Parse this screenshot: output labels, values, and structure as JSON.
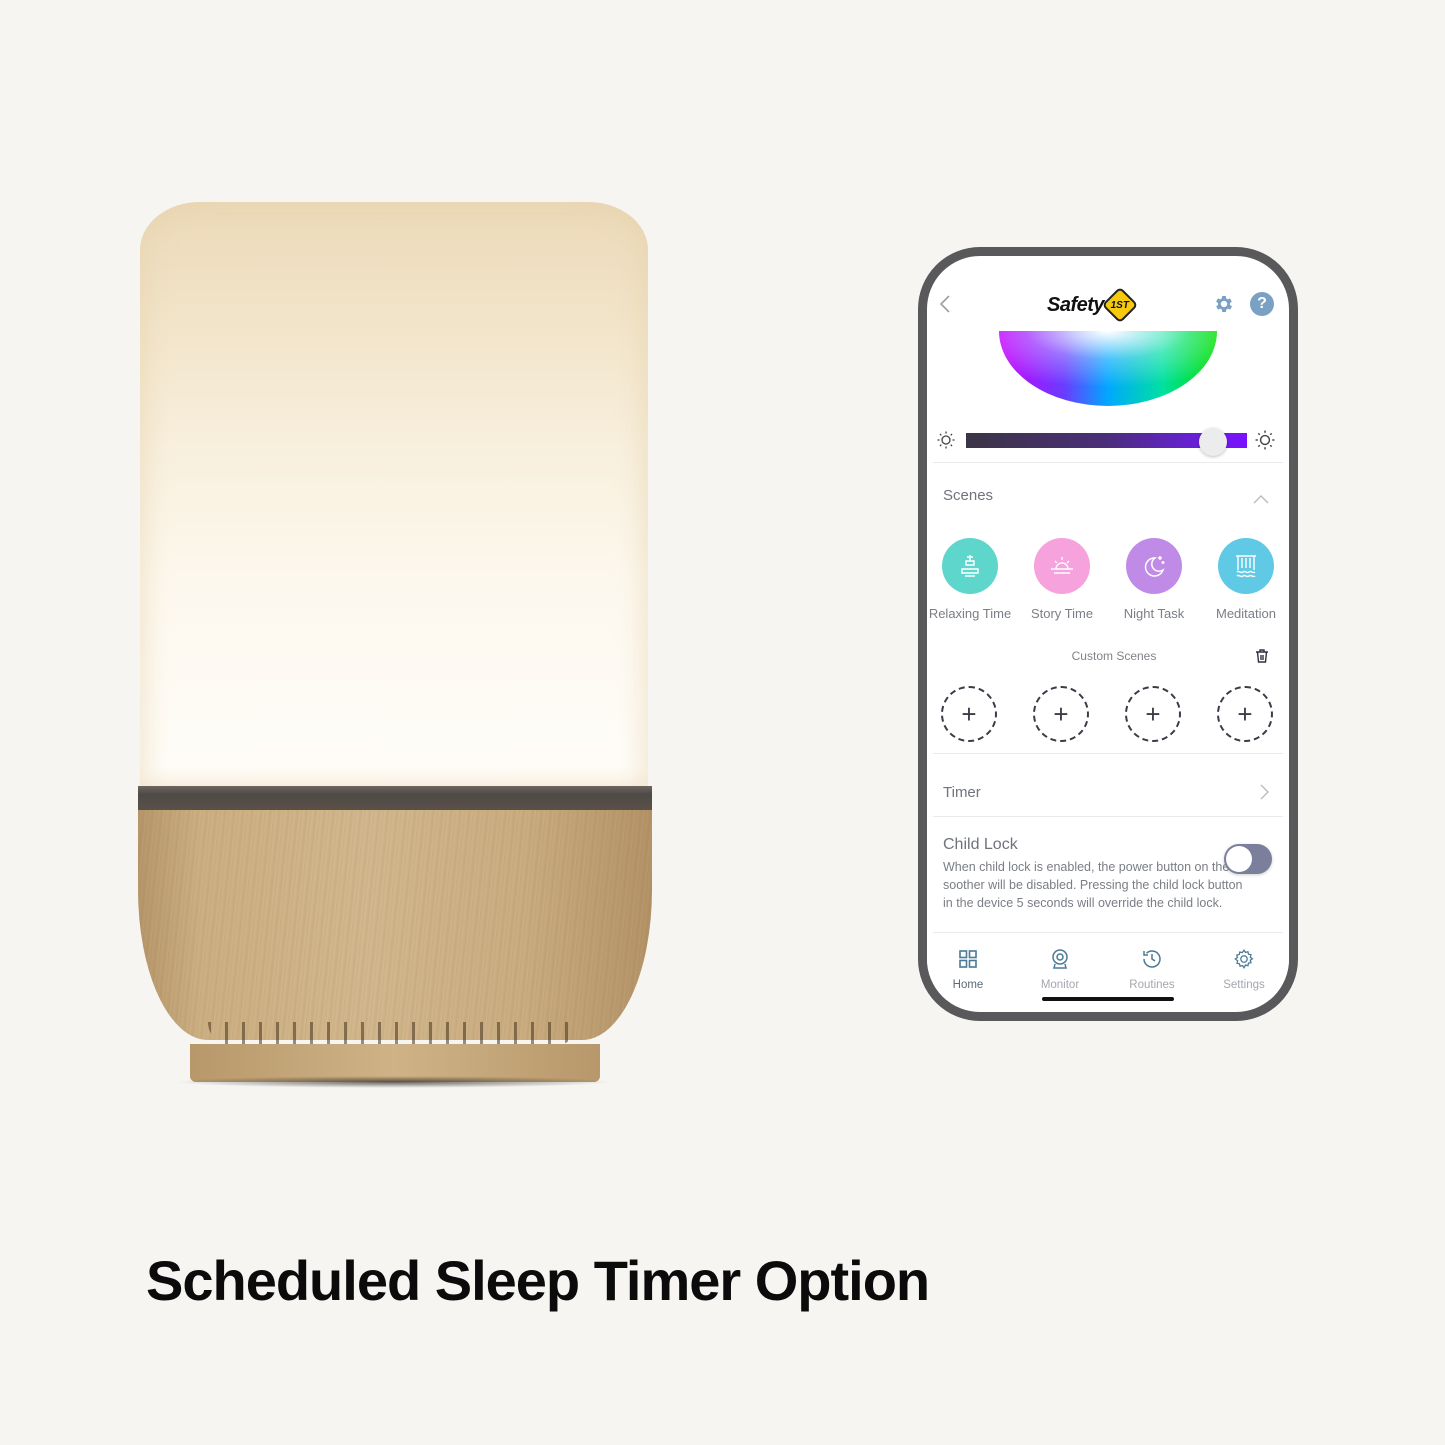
{
  "headline": "Scheduled Sleep Timer Option",
  "app": {
    "logo_text": "Safety",
    "logo_badge": "1ST",
    "help_label": "?",
    "brightness": {
      "value_percent": 88,
      "track_start_color": "#3b3545",
      "track_end_color": "#7a10ff"
    },
    "scenes": {
      "title": "Scenes",
      "items": [
        {
          "label": "Relaxing Time",
          "icon": "fountain-icon",
          "color": "#5fd6cc"
        },
        {
          "label": "Story Time",
          "icon": "sunrise-icon",
          "color": "#f6a2dd"
        },
        {
          "label": "Night Task",
          "icon": "moon-stars-icon",
          "color": "#c08be6"
        },
        {
          "label": "Meditation",
          "icon": "waterfall-icon",
          "color": "#5fc9e6"
        }
      ]
    },
    "custom_scenes": {
      "title": "Custom Scenes",
      "slots": [
        "+",
        "+",
        "+",
        "+"
      ]
    },
    "timer": {
      "label": "Timer"
    },
    "child_lock": {
      "title": "Child Lock",
      "description": "When child lock is enabled, the power button on the soother will be disabled. Pressing the child lock button in the device 5 seconds will override the child lock.",
      "enabled": false
    },
    "tabs": [
      {
        "label": "Home",
        "icon": "grid-icon",
        "active": true
      },
      {
        "label": "Monitor",
        "icon": "webcam-icon",
        "active": false
      },
      {
        "label": "Routines",
        "icon": "history-icon",
        "active": false
      },
      {
        "label": "Settings",
        "icon": "gear-icon",
        "active": false
      }
    ]
  }
}
